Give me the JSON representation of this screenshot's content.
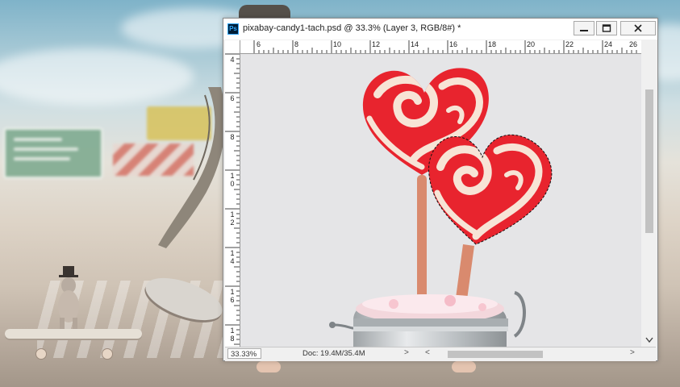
{
  "window": {
    "title": "pixabay-candy1-tach.psd @ 33.3% (Layer 3, RGB/8#) *",
    "app_icon_label": "Ps",
    "minimize_label": "—",
    "maximize_label": "☐",
    "close_label": "✕"
  },
  "ruler": {
    "horizontal": [
      "6",
      "8",
      "10",
      "12",
      "14",
      "16",
      "18",
      "20",
      "22",
      "24",
      "26"
    ],
    "vertical": [
      [
        "4"
      ],
      [
        "6"
      ],
      [
        "8"
      ],
      [
        "1",
        "0"
      ],
      [
        "1",
        "2"
      ],
      [
        "1",
        "4"
      ],
      [
        "1",
        "6"
      ],
      [
        "1",
        "8"
      ]
    ]
  },
  "status": {
    "zoom": "33.33%",
    "doc": "Doc: 19.4M/35.4M",
    "arrow": ">",
    "scroll_left": "<",
    "scroll_right": ">"
  },
  "icons": {
    "app": "photoshop-icon",
    "minimize": "minimize-icon",
    "maximize": "maximize-icon",
    "close": "close-icon"
  },
  "colors": {
    "lollipop_red": "#e8242e",
    "lollipop_cream": "#f7e4d6",
    "stick": "#d98a6e",
    "canvas": "#e5e5e7"
  }
}
